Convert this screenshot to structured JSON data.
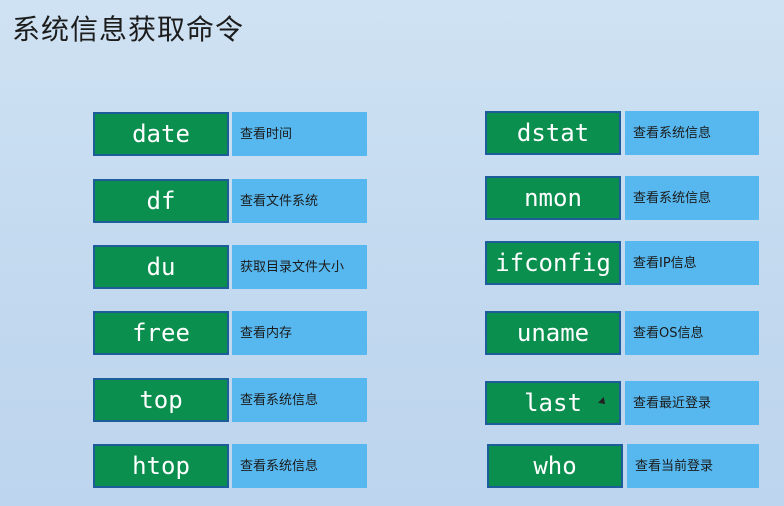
{
  "title": "系统信息获取命令",
  "left_commands": [
    {
      "command": "date",
      "description": "查看时间"
    },
    {
      "command": "df",
      "description": "查看文件系统"
    },
    {
      "command": "du",
      "description": "获取目录文件大小"
    },
    {
      "command": "free",
      "description": "查看内存"
    },
    {
      "command": "top",
      "description": "查看系统信息"
    },
    {
      "command": "htop",
      "description": "查看系统信息"
    }
  ],
  "right_commands": [
    {
      "command": "dstat",
      "description": "查看系统信息"
    },
    {
      "command": "nmon",
      "description": "查看系统信息"
    },
    {
      "command": "ifconfig",
      "description": "查看IP信息"
    },
    {
      "command": "uname",
      "description": "查看OS信息"
    },
    {
      "command": "last",
      "description": "查看最近登录"
    },
    {
      "command": "who",
      "description": "查看当前登录"
    }
  ],
  "colors": {
    "command_bg": "#0a8f4e",
    "description_bg": "#57b8ef",
    "background": "#c8dcf0"
  },
  "icons": {
    "mouse_pointer": "mouse-pointer-icon"
  }
}
